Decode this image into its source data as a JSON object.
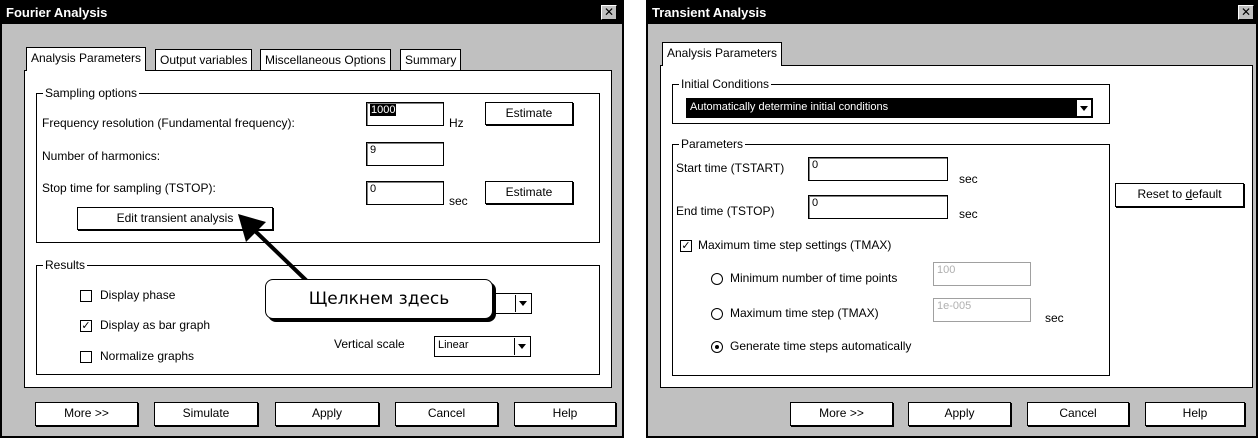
{
  "fourier": {
    "title": "Fourier Analysis",
    "close_glyph": "✕",
    "tabs": [
      "Analysis Parameters",
      "Output variables",
      "Miscellaneous Options",
      "Summary"
    ],
    "sampling": {
      "legend": "Sampling options",
      "freq_label": "Frequency resolution (Fundamental frequency):",
      "freq_value": "1000",
      "freq_unit": "Hz",
      "estimate1": "Estimate",
      "harmonics_label": "Number of harmonics:",
      "harmonics_value": "9",
      "stop_label": "Stop time for sampling (TSTOP):",
      "stop_value": "0",
      "stop_unit": "sec",
      "estimate2": "Estimate",
      "edit_button": "Edit transient analysis"
    },
    "results": {
      "legend": "Results",
      "display_phase": "Display phase",
      "display_phase_checked": false,
      "display_bar": "Display as bar graph",
      "display_bar_checked": true,
      "normalize": "Normalize graphs",
      "normalize_checked": false,
      "vertical_scale_label": "Vertical scale",
      "vertical_scale_value": "Linear"
    },
    "buttons": {
      "more": "More >>",
      "simulate": "Simulate",
      "apply": "Apply",
      "cancel": "Cancel",
      "help": "Help"
    }
  },
  "callout": {
    "text": "Щелкнем здесь"
  },
  "transient": {
    "title": "Transient Analysis",
    "close_glyph": "✕",
    "tab": "Analysis Parameters",
    "initial": {
      "legend": "Initial Conditions",
      "value": "Automatically determine initial conditions"
    },
    "params": {
      "legend": "Parameters",
      "start_label": "Start time (TSTART)",
      "start_value": "0",
      "start_unit": "sec",
      "end_label": "End time (TSTOP)",
      "end_value": "0",
      "end_unit": "sec",
      "tmax_settings": "Maximum time step settings (TMAX)",
      "tmax_settings_checked": true,
      "min_points_label": "Minimum number of time points",
      "min_points_value": "100",
      "max_step_label": "Maximum time step (TMAX)",
      "max_step_value": "1e-005",
      "max_step_unit": "sec",
      "generate_label": "Generate time steps automatically",
      "selected_option": "generate"
    },
    "reset_prefix": "Reset to ",
    "reset_underlined": "d",
    "reset_suffix": "efault",
    "buttons": {
      "more": "More >>",
      "apply": "Apply",
      "cancel": "Cancel",
      "help": "Help"
    }
  }
}
